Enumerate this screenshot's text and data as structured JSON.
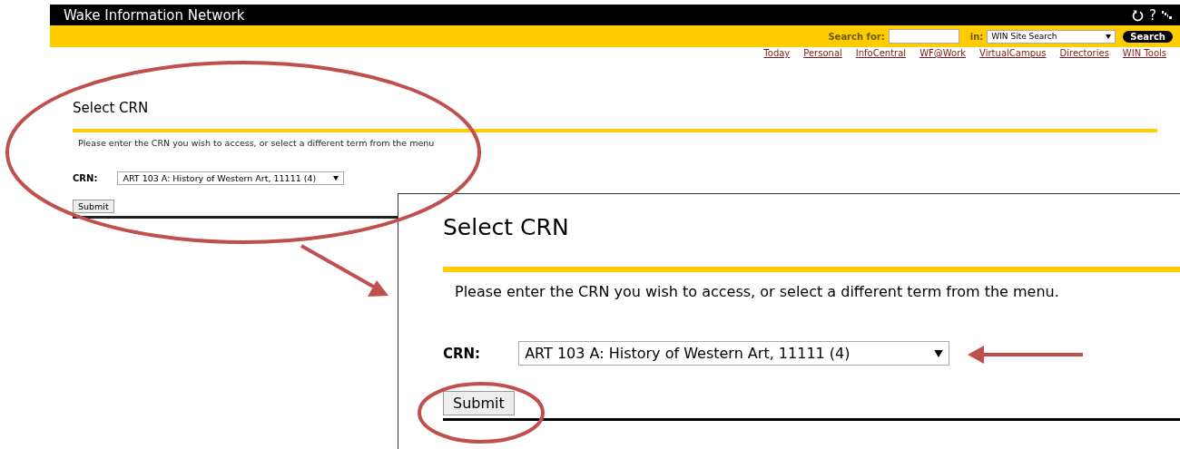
{
  "header": {
    "title": "Wake Information Network",
    "help_symbol": "?"
  },
  "search": {
    "label": "Search for:",
    "scope_label": "in:",
    "scope": "WIN Site Search",
    "button": "Search"
  },
  "nav_links": [
    "Today",
    "Personal",
    "InfoCentral",
    "WF@Work",
    "VirtualCampus",
    "Directories",
    "WIN Tools"
  ],
  "page": {
    "heading": "Select CRN",
    "message": "Please enter the CRN you wish to access, or select a different term from the menu",
    "crn_label": "CRN:",
    "crn_value": "ART 103 A: History of Western Art, 11111 (4)",
    "submit": "Submit"
  },
  "zoom_inset": {
    "heading": "Select CRN",
    "message": "Please enter the CRN you wish to access, or select a different term from the menu.",
    "crn_label": "CRN:",
    "crn_value": "ART 103 A: History of Western Art, 11111 (4)",
    "submit": "Submit"
  }
}
